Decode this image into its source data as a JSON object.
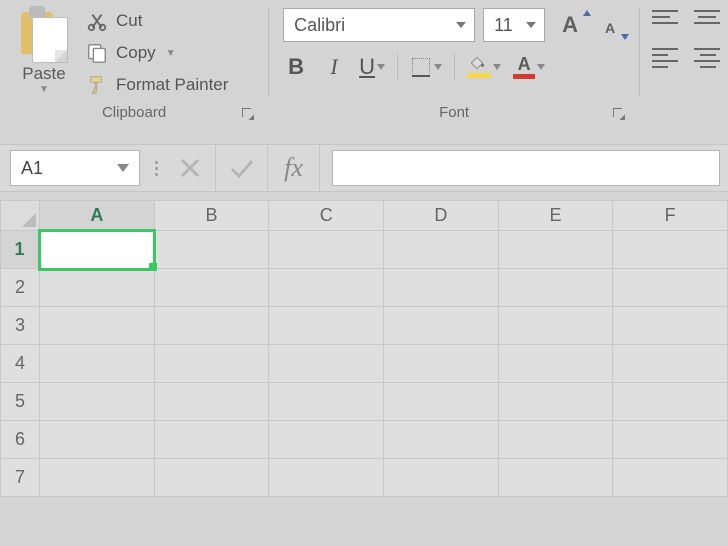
{
  "ribbon": {
    "clipboard": {
      "group_label": "Clipboard",
      "paste_label": "Paste",
      "cut_label": "Cut",
      "copy_label": "Copy",
      "format_painter_label": "Format Painter"
    },
    "font": {
      "group_label": "Font",
      "font_name": "Calibri",
      "font_size": "11"
    }
  },
  "formula_bar": {
    "name_box": "A1",
    "fx_label": "fx",
    "formula_value": ""
  },
  "grid": {
    "columns": [
      "A",
      "B",
      "C",
      "D",
      "E",
      "F"
    ],
    "rows": [
      "1",
      "2",
      "3",
      "4",
      "5",
      "6",
      "7"
    ],
    "active_cell": "A1"
  }
}
